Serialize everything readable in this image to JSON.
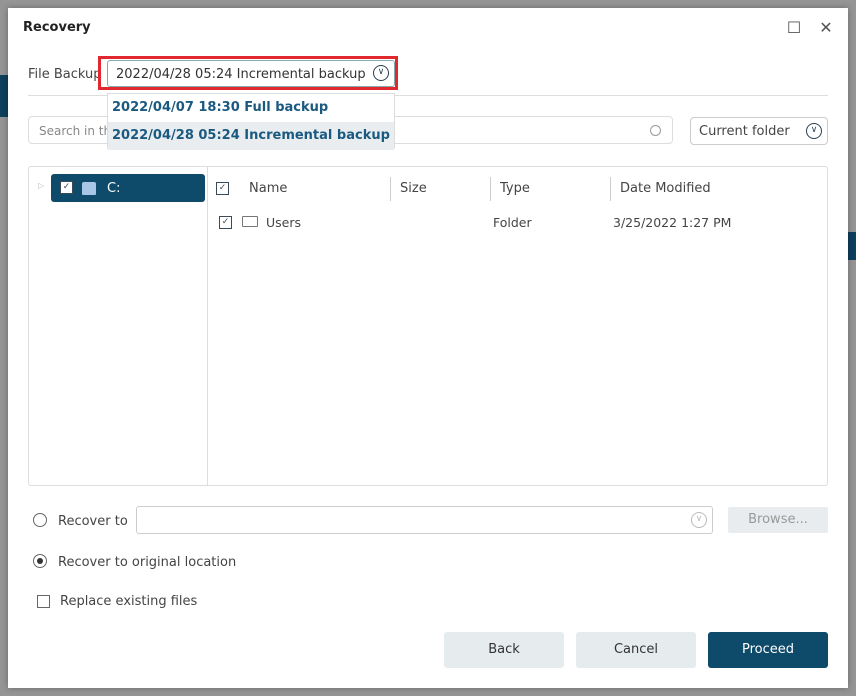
{
  "dialog": {
    "title": "Recovery"
  },
  "file_backup": {
    "label": "File Backup",
    "selected": "2022/04/28 05:24 Incremental backup",
    "options": [
      {
        "label": "2022/04/07 18:30 Full backup"
      },
      {
        "label": "2022/04/28 05:24 Incremental backup"
      }
    ]
  },
  "search": {
    "placeholder": "Search in th"
  },
  "scope": {
    "selected": "Current folder"
  },
  "tree": {
    "node": "C:"
  },
  "table": {
    "headers": [
      "Name",
      "Size",
      "Type",
      "Date Modified"
    ],
    "rows": [
      {
        "name": "Users",
        "size": "",
        "type": "Folder",
        "date": "3/25/2022 1:27 PM"
      }
    ]
  },
  "options": {
    "recover_to": "Recover to",
    "browse": "Browse...",
    "original": "Recover to original location",
    "replace": "Replace existing files"
  },
  "buttons": {
    "back": "Back",
    "cancel": "Cancel",
    "proceed": "Proceed"
  }
}
